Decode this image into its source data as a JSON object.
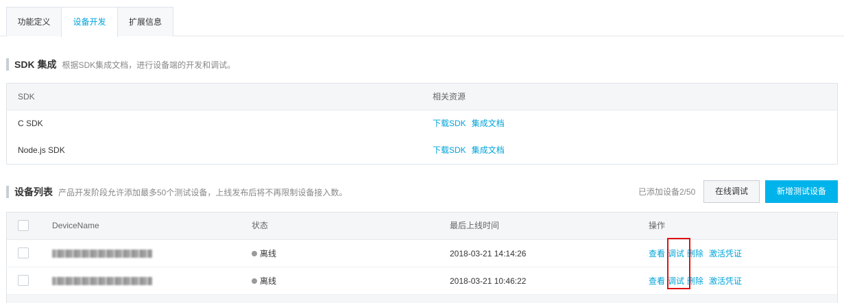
{
  "tabs": [
    {
      "label": "功能定义"
    },
    {
      "label": "设备开发"
    },
    {
      "label": "扩展信息"
    }
  ],
  "sdk_section": {
    "title": "SDK 集成",
    "description": "根据SDK集成文档，进行设备端的开发和调试。",
    "columns": [
      "SDK",
      "相关资源"
    ],
    "rows": [
      {
        "name": "C SDK",
        "download": "下载SDK",
        "docs": "集成文档"
      },
      {
        "name": "Node.js SDK",
        "download": "下载SDK",
        "docs": "集成文档"
      }
    ]
  },
  "device_section": {
    "title": "设备列表",
    "description": "产品开发阶段允许添加最多50个测试设备，上线发布后将不再限制设备接入数。",
    "count_text": "已添加设备2/50",
    "online_debug_label": "在线调试",
    "add_device_label": "新增测试设备",
    "columns": [
      "DeviceName",
      "状态",
      "最后上线时间",
      "操作"
    ],
    "rows": [
      {
        "status": "离线",
        "last_online": "2018-03-21 14:14:26",
        "actions": [
          "查看",
          "调试",
          "删除",
          "激活凭证"
        ]
      },
      {
        "status": "离线",
        "last_online": "2018-03-21 10:46:22",
        "actions": [
          "查看",
          "调试",
          "删除",
          "激活凭证"
        ]
      }
    ]
  },
  "colors": {
    "accent": "#00a3d9",
    "primary_button": "#00b4eb",
    "highlight": "#e01010",
    "offline_dot": "#9a9a9a"
  }
}
